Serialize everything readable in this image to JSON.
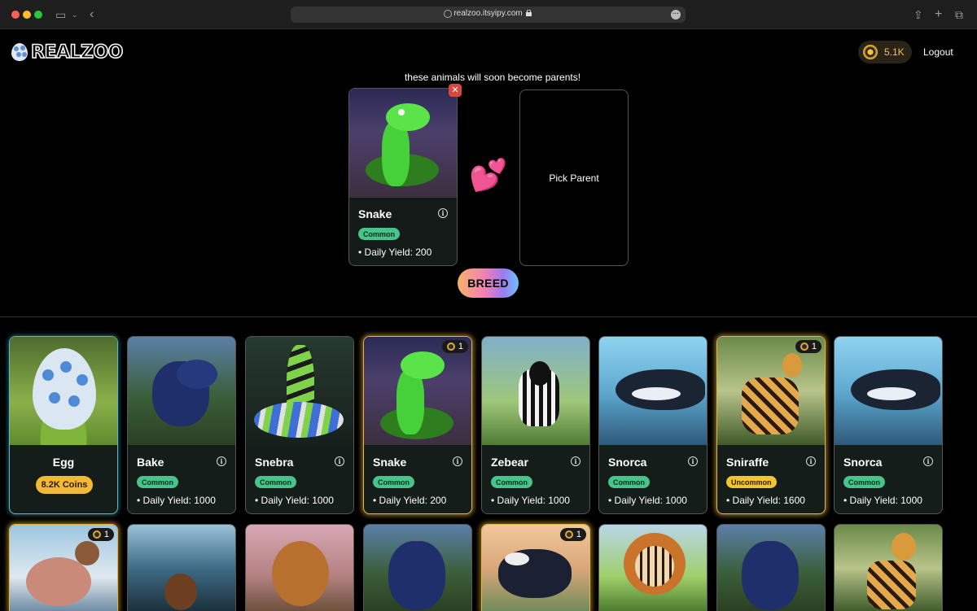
{
  "browser": {
    "url": "realzoo.itsyipy.com"
  },
  "header": {
    "logo_text": "REALZOO",
    "coins": "5.1K",
    "logout_label": "Logout"
  },
  "breeding": {
    "caption": "these animals will soon become parents!",
    "remove_label": "✕",
    "parent": {
      "name": "Snake",
      "rarity": "Common",
      "yield": "• Daily Yield: 200"
    },
    "pick_label": "Pick Parent",
    "breed_label": "BREED"
  },
  "egg_card": {
    "name": "Egg",
    "price": "8.2K Coins"
  },
  "cards": [
    {
      "name": "Bake",
      "rarity": "Common",
      "yield": "• Daily Yield: 1000"
    },
    {
      "name": "Snebra",
      "rarity": "Common",
      "yield": "• Daily Yield: 1000"
    },
    {
      "name": "Snake",
      "rarity": "Common",
      "yield": "• Daily Yield: 200",
      "count": "1"
    },
    {
      "name": "Zebear",
      "rarity": "Common",
      "yield": "• Daily Yield: 1000"
    },
    {
      "name": "Snorca",
      "rarity": "Common",
      "yield": "• Daily Yield: 1000"
    },
    {
      "name": "Sniraffe",
      "rarity": "Uncommon",
      "yield": "• Daily Yield: 1600",
      "count": "1"
    },
    {
      "name": "Snorca",
      "rarity": "Common",
      "yield": "• Daily Yield: 1000"
    }
  ],
  "second_row_badges": {
    "moose_count": "1",
    "orca_count": "1"
  },
  "colors": {
    "common": "#47c48a",
    "uncommon": "#f2c530",
    "gold_border": "#e0b54a",
    "egg_border": "#54b9c9"
  }
}
